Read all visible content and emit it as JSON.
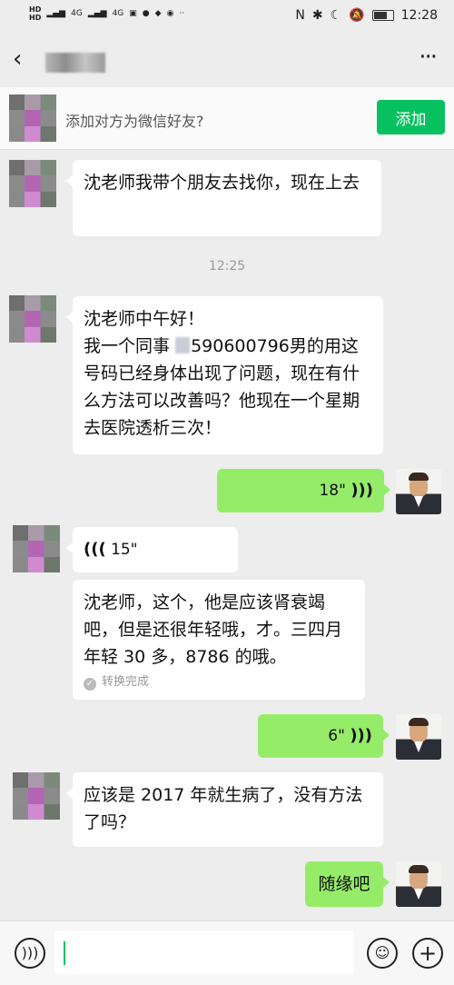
{
  "status_bar": {
    "hd1": "HD",
    "hd2": "HD",
    "net1": "4G",
    "net2": "4G",
    "time": "12:28"
  },
  "nav": {
    "back_icon": "chevron-left-icon",
    "more_icon": "more-dots-icon"
  },
  "friend_prompt": {
    "text": "添加对方为微信好友?",
    "button": "添加"
  },
  "messages": {
    "m1": "沈老师我带个朋友去找你，现在上去",
    "time1": "12:25",
    "m2_line1": "沈老师中午好！",
    "m2_prefix": "我一个同事",
    "m2_number": "590600796",
    "m2_rest": "男的用这号码已经身体出现了问题，现在有什么方法可以改善吗？他现在一个星期去医院透析三次！",
    "voice_out_1": "18\"",
    "voice_in_1": "15\"",
    "transcript": "沈老师，这个，他是应该肾衰竭吧，但是还很年轻哦，才。三四月年轻 30 多，8786 的哦。",
    "transcript_status": "转换完成",
    "voice_out_2": "6\"",
    "m3": "应该是 2017 年就生病了，没有方法了吗？",
    "m4": "随缘吧"
  },
  "colors": {
    "accent": "#07c160",
    "bubble_out": "#95ec69",
    "background": "#ededed"
  }
}
